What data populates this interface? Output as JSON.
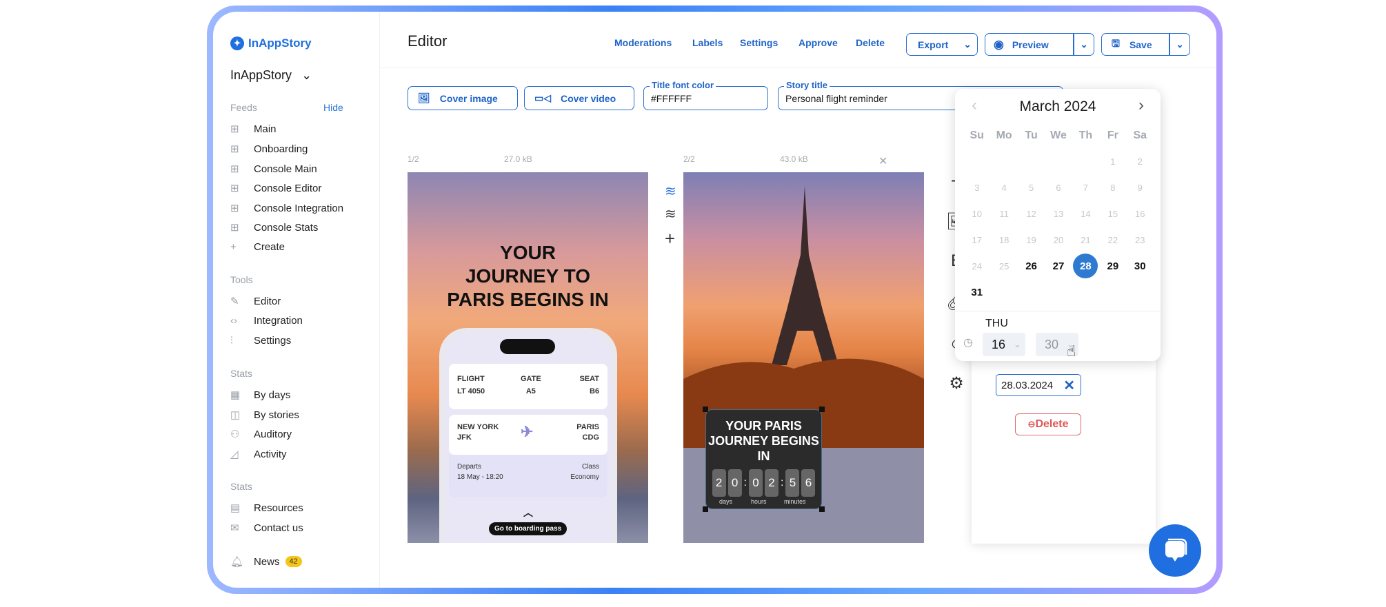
{
  "sidebar": {
    "logo": "InAppStory",
    "org": "InAppStory",
    "feeds_label": "Feeds",
    "hide": "Hide",
    "feeds": [
      "Main",
      "Onboarding",
      "Console Main",
      "Console Editor",
      "Console Integration",
      "Console Stats",
      "Create"
    ],
    "tools_label": "Tools",
    "tools": [
      "Editor",
      "Integration",
      "Settings"
    ],
    "stats_label": "Stats",
    "stats": [
      "By days",
      "By stories",
      "Auditory",
      "Activity"
    ],
    "stats2_label": "Stats",
    "stats2": [
      "Resources",
      "Contact us"
    ],
    "news": "News",
    "news_count": "42"
  },
  "header": {
    "title": "Editor",
    "links": [
      "Moderations",
      "Labels",
      "Settings",
      "Approve",
      "Delete"
    ],
    "export": "Export",
    "preview": "Preview",
    "save": "Save"
  },
  "toolbar": {
    "cover_image": "Cover image",
    "cover_video": "Cover video",
    "font_color_label": "Title font color",
    "font_color": "#FFFFFF",
    "story_title_label": "Story title",
    "story_title": "Personal flight reminder"
  },
  "slides": [
    {
      "index": "1/2",
      "size": "27.0 kB",
      "headline": [
        "YOUR",
        "JOURNEY TO",
        "PARIS BEGINS IN"
      ],
      "flight_label": "FLIGHT",
      "flight": "LT 4050",
      "gate_label": "GATE",
      "gate": "A5",
      "seat_label": "SEAT",
      "seat": "B6",
      "from_city": "NEW YORK",
      "from_code": "JFK",
      "to_city": "PARIS",
      "to_code": "CDG",
      "departs_label": "Departs",
      "departs": "18 May - 18:20",
      "class_label": "Class",
      "class": "Economy",
      "cta": "Go to boarding pass"
    },
    {
      "index": "2/2",
      "size": "43.0 kB",
      "headline": [
        "YOUR PARIS",
        "JOURNEY BEGINS IN"
      ],
      "digits": [
        "2",
        "0",
        "0",
        "2",
        "5",
        "6"
      ],
      "units": [
        "days",
        "hours",
        "minutes"
      ]
    }
  ],
  "calendar": {
    "month": "March 2024",
    "weekdays": [
      "Su",
      "Mo",
      "Tu",
      "We",
      "Th",
      "Fr",
      "Sa"
    ],
    "selected_day": "28",
    "weekday_label": "THU",
    "hour": "16",
    "minute": "30"
  },
  "panel": {
    "date": "28.03.2024",
    "delete": "Delete"
  },
  "colors": {
    "accent": "#1f63c9",
    "selected": "#2e7ad1",
    "danger": "#e05555",
    "badge": "#f5c518"
  }
}
